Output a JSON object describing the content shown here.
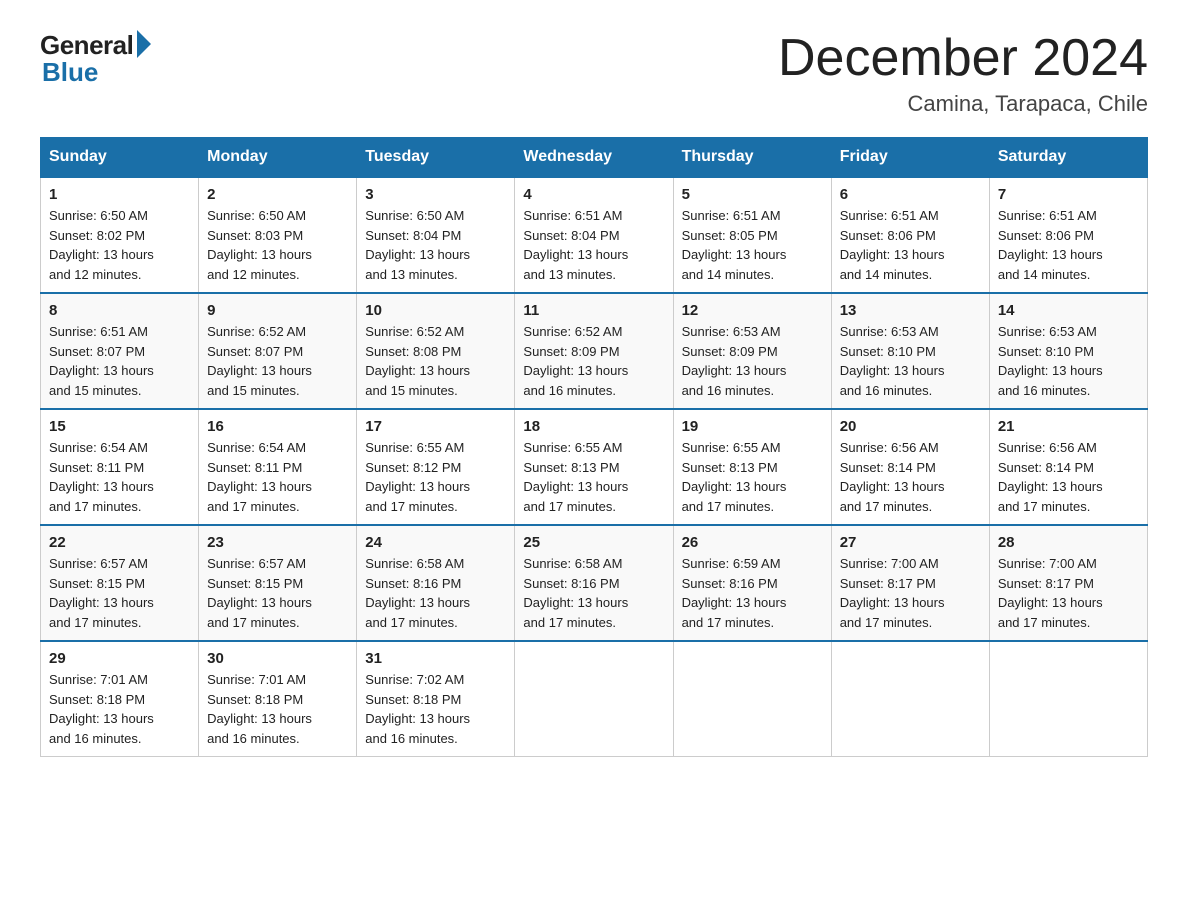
{
  "logo": {
    "general": "General",
    "blue": "Blue"
  },
  "title": "December 2024",
  "subtitle": "Camina, Tarapaca, Chile",
  "weekdays": [
    "Sunday",
    "Monday",
    "Tuesday",
    "Wednesday",
    "Thursday",
    "Friday",
    "Saturday"
  ],
  "weeks": [
    [
      {
        "day": "1",
        "sunrise": "6:50 AM",
        "sunset": "8:02 PM",
        "daylight": "13 hours and 12 minutes."
      },
      {
        "day": "2",
        "sunrise": "6:50 AM",
        "sunset": "8:03 PM",
        "daylight": "13 hours and 12 minutes."
      },
      {
        "day": "3",
        "sunrise": "6:50 AM",
        "sunset": "8:04 PM",
        "daylight": "13 hours and 13 minutes."
      },
      {
        "day": "4",
        "sunrise": "6:51 AM",
        "sunset": "8:04 PM",
        "daylight": "13 hours and 13 minutes."
      },
      {
        "day": "5",
        "sunrise": "6:51 AM",
        "sunset": "8:05 PM",
        "daylight": "13 hours and 14 minutes."
      },
      {
        "day": "6",
        "sunrise": "6:51 AM",
        "sunset": "8:06 PM",
        "daylight": "13 hours and 14 minutes."
      },
      {
        "day": "7",
        "sunrise": "6:51 AM",
        "sunset": "8:06 PM",
        "daylight": "13 hours and 14 minutes."
      }
    ],
    [
      {
        "day": "8",
        "sunrise": "6:51 AM",
        "sunset": "8:07 PM",
        "daylight": "13 hours and 15 minutes."
      },
      {
        "day": "9",
        "sunrise": "6:52 AM",
        "sunset": "8:07 PM",
        "daylight": "13 hours and 15 minutes."
      },
      {
        "day": "10",
        "sunrise": "6:52 AM",
        "sunset": "8:08 PM",
        "daylight": "13 hours and 15 minutes."
      },
      {
        "day": "11",
        "sunrise": "6:52 AM",
        "sunset": "8:09 PM",
        "daylight": "13 hours and 16 minutes."
      },
      {
        "day": "12",
        "sunrise": "6:53 AM",
        "sunset": "8:09 PM",
        "daylight": "13 hours and 16 minutes."
      },
      {
        "day": "13",
        "sunrise": "6:53 AM",
        "sunset": "8:10 PM",
        "daylight": "13 hours and 16 minutes."
      },
      {
        "day": "14",
        "sunrise": "6:53 AM",
        "sunset": "8:10 PM",
        "daylight": "13 hours and 16 minutes."
      }
    ],
    [
      {
        "day": "15",
        "sunrise": "6:54 AM",
        "sunset": "8:11 PM",
        "daylight": "13 hours and 17 minutes."
      },
      {
        "day": "16",
        "sunrise": "6:54 AM",
        "sunset": "8:11 PM",
        "daylight": "13 hours and 17 minutes."
      },
      {
        "day": "17",
        "sunrise": "6:55 AM",
        "sunset": "8:12 PM",
        "daylight": "13 hours and 17 minutes."
      },
      {
        "day": "18",
        "sunrise": "6:55 AM",
        "sunset": "8:13 PM",
        "daylight": "13 hours and 17 minutes."
      },
      {
        "day": "19",
        "sunrise": "6:55 AM",
        "sunset": "8:13 PM",
        "daylight": "13 hours and 17 minutes."
      },
      {
        "day": "20",
        "sunrise": "6:56 AM",
        "sunset": "8:14 PM",
        "daylight": "13 hours and 17 minutes."
      },
      {
        "day": "21",
        "sunrise": "6:56 AM",
        "sunset": "8:14 PM",
        "daylight": "13 hours and 17 minutes."
      }
    ],
    [
      {
        "day": "22",
        "sunrise": "6:57 AM",
        "sunset": "8:15 PM",
        "daylight": "13 hours and 17 minutes."
      },
      {
        "day": "23",
        "sunrise": "6:57 AM",
        "sunset": "8:15 PM",
        "daylight": "13 hours and 17 minutes."
      },
      {
        "day": "24",
        "sunrise": "6:58 AM",
        "sunset": "8:16 PM",
        "daylight": "13 hours and 17 minutes."
      },
      {
        "day": "25",
        "sunrise": "6:58 AM",
        "sunset": "8:16 PM",
        "daylight": "13 hours and 17 minutes."
      },
      {
        "day": "26",
        "sunrise": "6:59 AM",
        "sunset": "8:16 PM",
        "daylight": "13 hours and 17 minutes."
      },
      {
        "day": "27",
        "sunrise": "7:00 AM",
        "sunset": "8:17 PM",
        "daylight": "13 hours and 17 minutes."
      },
      {
        "day": "28",
        "sunrise": "7:00 AM",
        "sunset": "8:17 PM",
        "daylight": "13 hours and 17 minutes."
      }
    ],
    [
      {
        "day": "29",
        "sunrise": "7:01 AM",
        "sunset": "8:18 PM",
        "daylight": "13 hours and 16 minutes."
      },
      {
        "day": "30",
        "sunrise": "7:01 AM",
        "sunset": "8:18 PM",
        "daylight": "13 hours and 16 minutes."
      },
      {
        "day": "31",
        "sunrise": "7:02 AM",
        "sunset": "8:18 PM",
        "daylight": "13 hours and 16 minutes."
      },
      null,
      null,
      null,
      null
    ]
  ],
  "labels": {
    "sunrise": "Sunrise:",
    "sunset": "Sunset:",
    "daylight": "Daylight:"
  },
  "colors": {
    "header_bg": "#1a6fa8",
    "header_text": "#ffffff",
    "border_top": "#1a6fa8"
  }
}
